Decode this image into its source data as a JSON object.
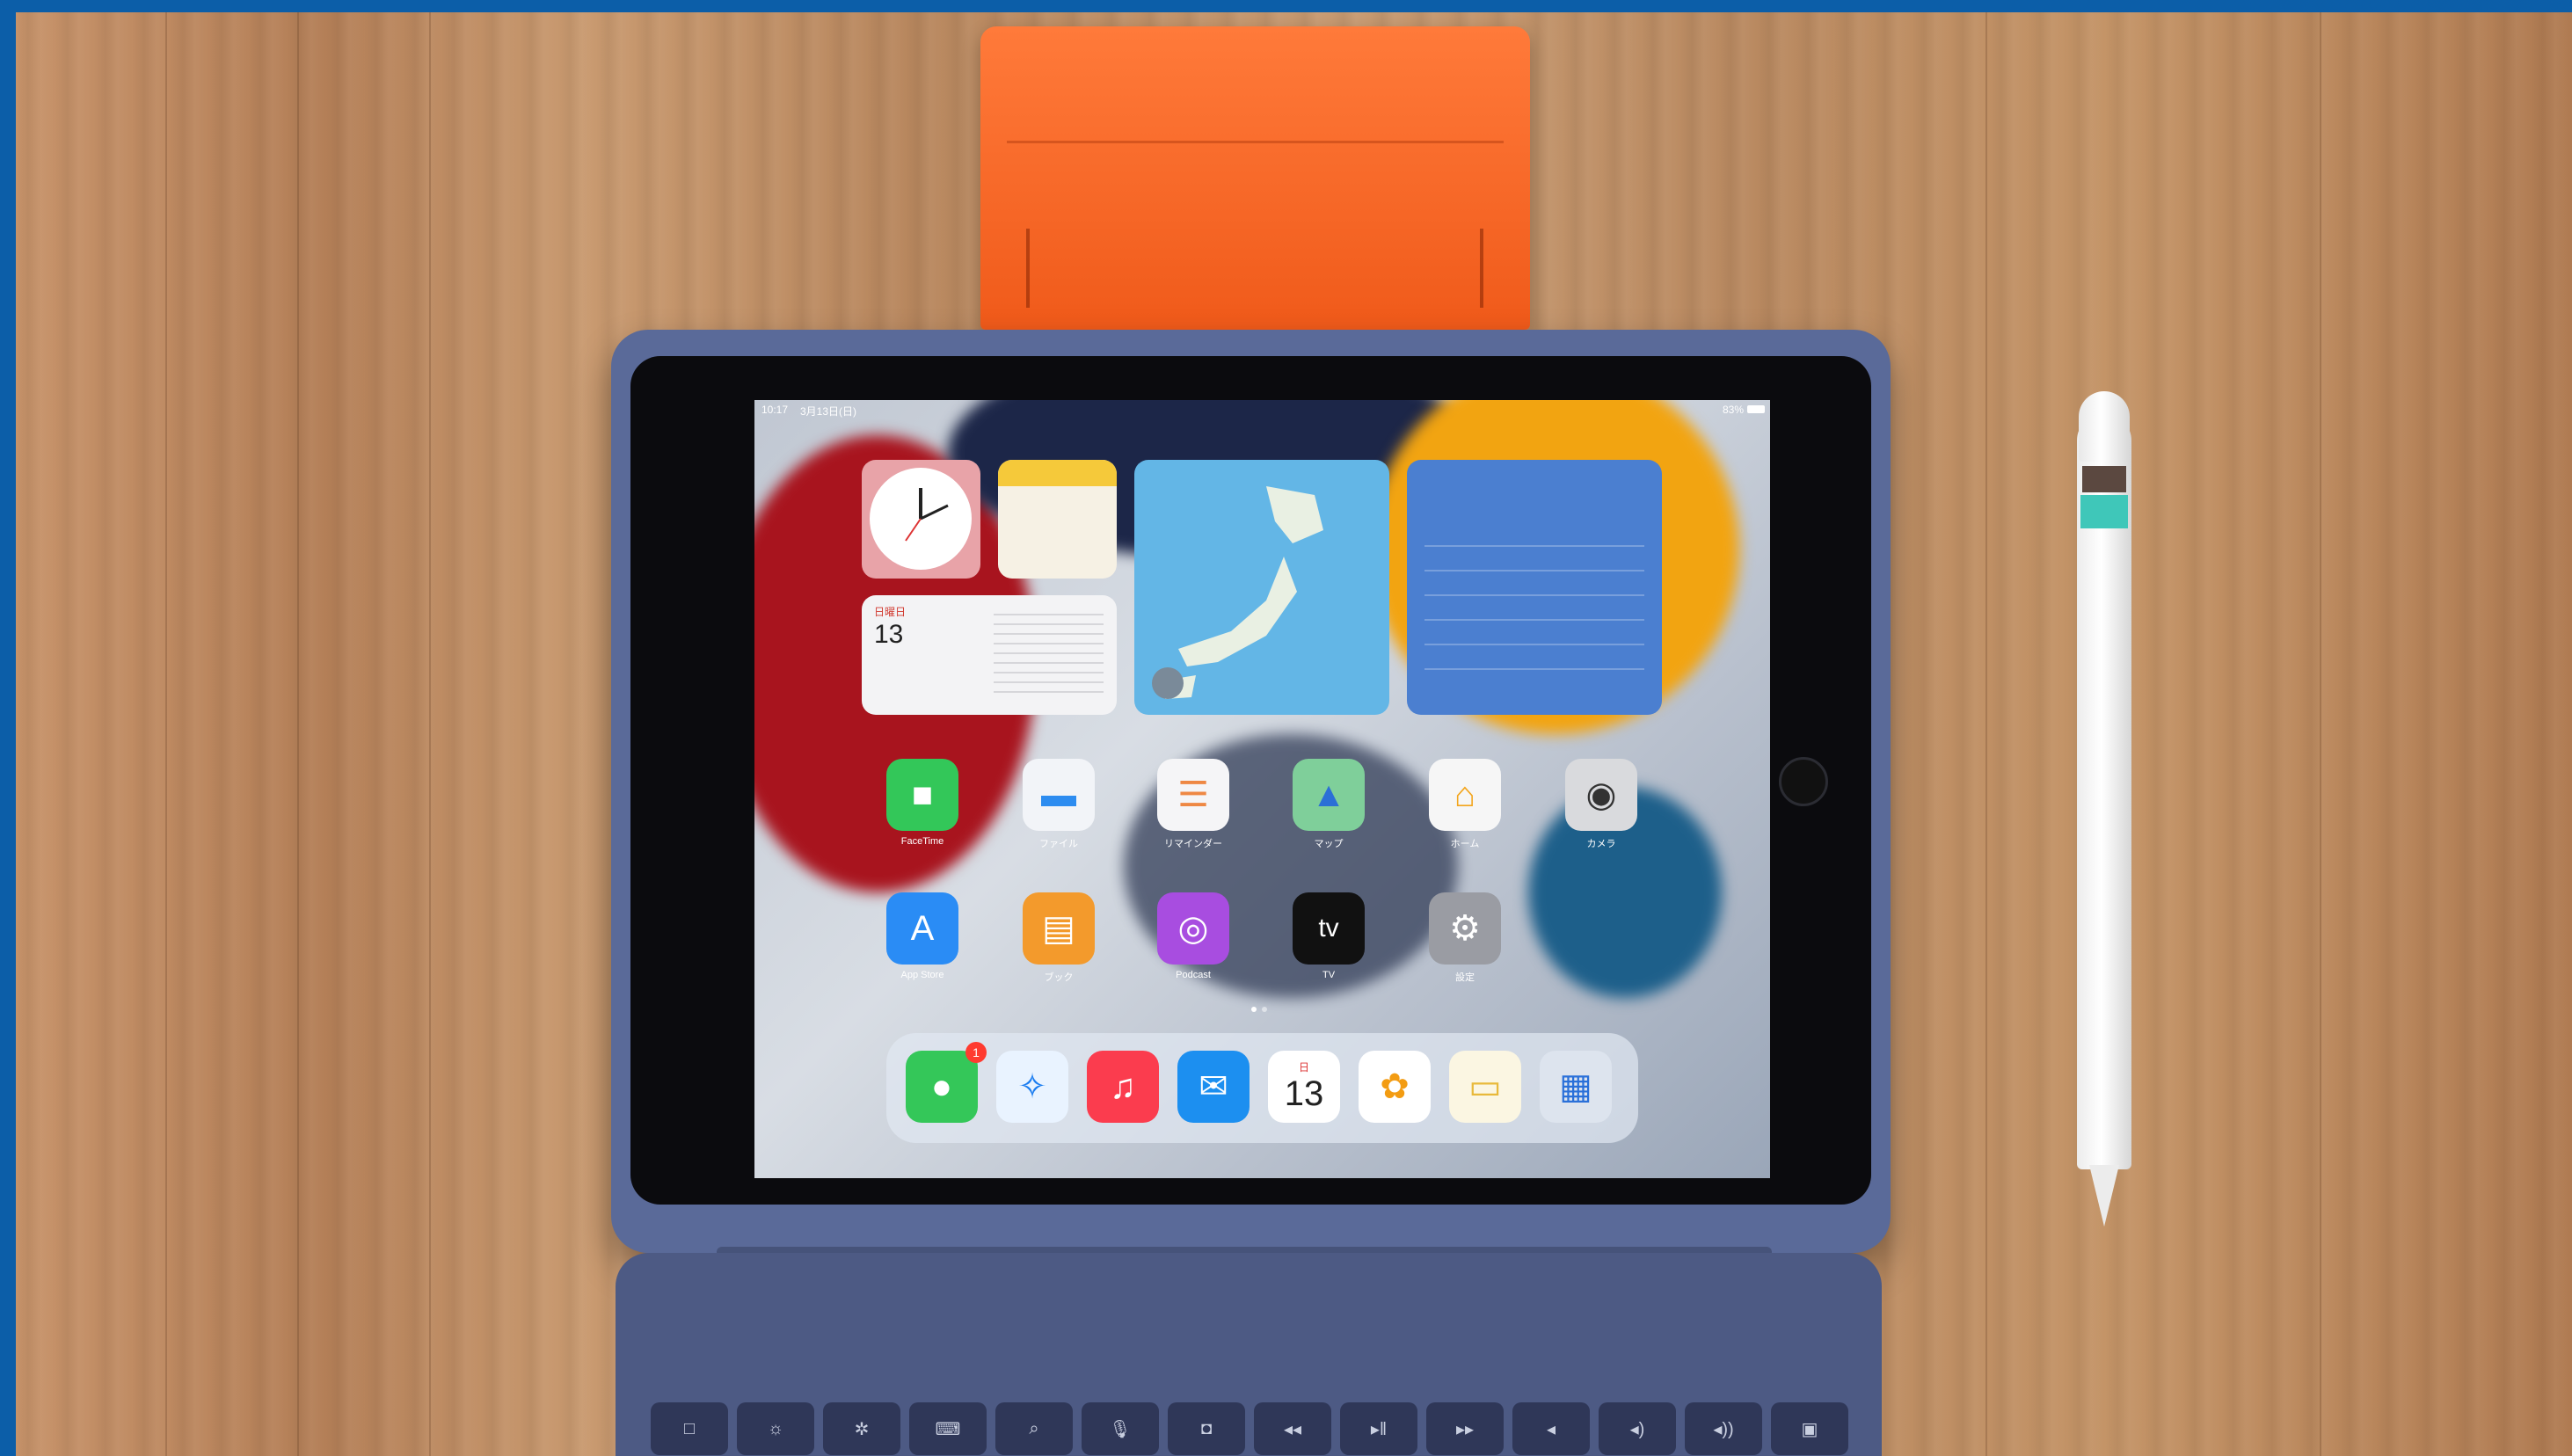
{
  "screen": {
    "status_time": "10:17",
    "status_date": "3月13日(日)",
    "status_battery": "83%",
    "widgets": {
      "calendar_day_label": "日曜日",
      "calendar_date": "13"
    },
    "apps_row1": [
      {
        "name": "FaceTime",
        "icon": "facetime-icon"
      },
      {
        "name": "ファイル",
        "icon": "files-icon"
      },
      {
        "name": "リマインダー",
        "icon": "reminders-icon"
      },
      {
        "name": "マップ",
        "icon": "maps-icon"
      },
      {
        "name": "ホーム",
        "icon": "home-icon"
      },
      {
        "name": "カメラ",
        "icon": "camera-icon"
      }
    ],
    "apps_row2": [
      {
        "name": "App Store",
        "icon": "appstore-icon"
      },
      {
        "name": "ブック",
        "icon": "books-icon"
      },
      {
        "name": "Podcast",
        "icon": "podcast-icon"
      },
      {
        "name": "TV",
        "icon": "tv-icon"
      },
      {
        "name": "設定",
        "icon": "settings-icon"
      }
    ],
    "tv_glyph": "tv",
    "dock": [
      {
        "icon": "messages-icon",
        "badge": "1"
      },
      {
        "icon": "safari-icon"
      },
      {
        "icon": "music-icon"
      },
      {
        "icon": "mail-icon"
      },
      {
        "icon": "calendar-icon",
        "date": "13",
        "day": "日"
      },
      {
        "icon": "photos-icon"
      },
      {
        "icon": "notes-icon"
      },
      {
        "icon": "app-library-icon"
      }
    ]
  },
  "colors": {
    "border": "#0c5ea8",
    "stand": "#f0601e",
    "case": "#5a6a99",
    "keyboard": "#4d5a84",
    "pencil_band": "#3fc7b9"
  }
}
